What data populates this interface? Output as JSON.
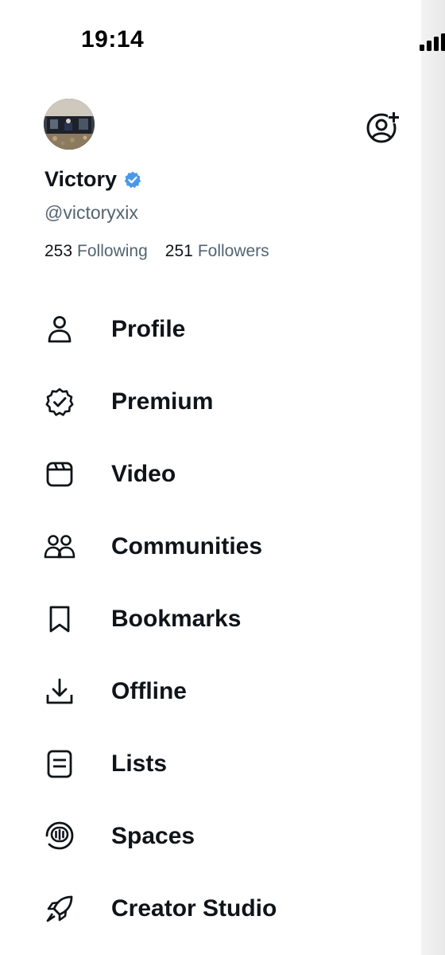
{
  "status_bar": {
    "time": "19:14",
    "signal_icon": "cellular-signal-icon"
  },
  "profile": {
    "avatar_icon": "profile-photo",
    "display_name": "Victory",
    "verified_icon": "verified-badge-icon",
    "verified_color": "#4a99e9",
    "handle": "@victoryxix",
    "following_count": "253",
    "following_label": "Following",
    "followers_count": "251",
    "followers_label": "Followers",
    "add_account_icon": "add-account-icon"
  },
  "menu": {
    "items": [
      {
        "label": "Profile",
        "icon": "person-icon"
      },
      {
        "label": "Premium",
        "icon": "premium-badge-icon"
      },
      {
        "label": "Video",
        "icon": "video-clapper-icon"
      },
      {
        "label": "Communities",
        "icon": "communities-icon"
      },
      {
        "label": "Bookmarks",
        "icon": "bookmark-icon"
      },
      {
        "label": "Offline",
        "icon": "download-icon"
      },
      {
        "label": "Lists",
        "icon": "list-icon"
      },
      {
        "label": "Spaces",
        "icon": "spaces-icon"
      },
      {
        "label": "Creator Studio",
        "icon": "rocket-icon"
      }
    ]
  },
  "colors": {
    "text_primary": "#0f1419",
    "text_secondary": "#536471",
    "background": "#ffffff"
  }
}
